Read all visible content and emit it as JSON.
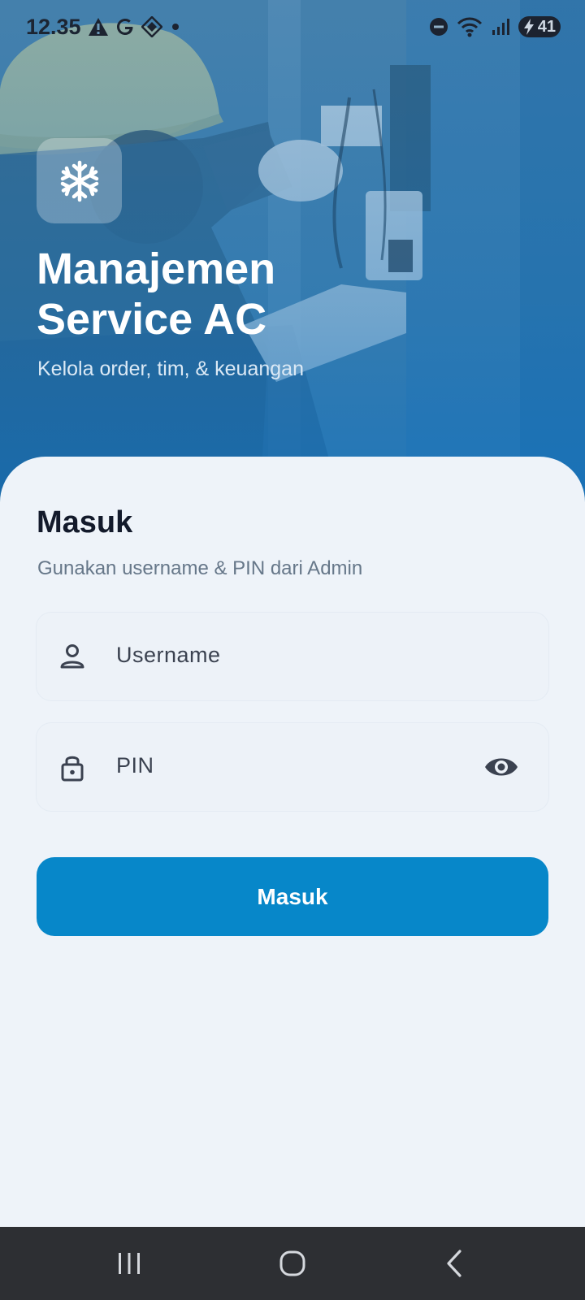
{
  "status_bar": {
    "time": "12.35",
    "battery_level": "41",
    "icons": [
      "warning-icon",
      "google-icon",
      "app-icon",
      "dot-icon",
      "dnd-icon",
      "wifi-icon",
      "signal-icon",
      "battery-icon"
    ]
  },
  "hero": {
    "logo_icon": "snowflake-icon",
    "title": "Manajemen\nService AC",
    "subtitle": "Kelola order, tim, & keuangan"
  },
  "login": {
    "title": "Masuk",
    "subtitle": "Gunakan username & PIN dari Admin",
    "username_placeholder": "Username",
    "pin_placeholder": "PIN",
    "submit_label": "Masuk"
  },
  "navigation": {
    "icons": [
      "recent-apps-icon",
      "home-icon",
      "back-icon"
    ]
  },
  "colors": {
    "accent": "#0787c9",
    "card_background": "#eef3f9",
    "title_text": "#131a2b",
    "muted_text": "#667789",
    "nav_background": "#2d2f33"
  }
}
